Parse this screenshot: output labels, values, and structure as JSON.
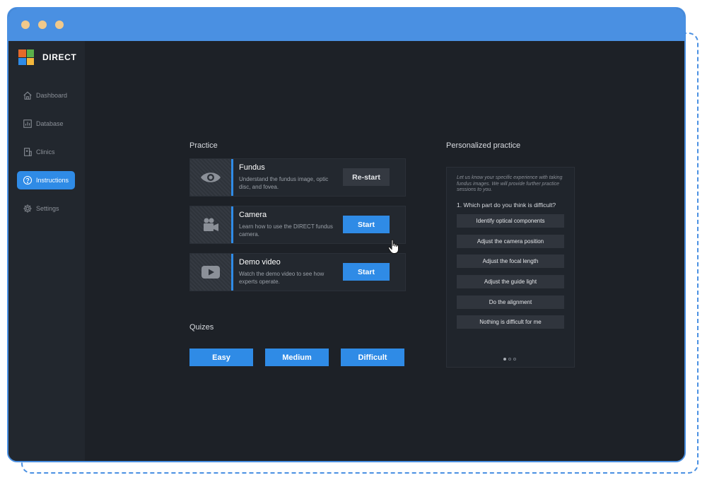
{
  "app": {
    "name": "DIRECT"
  },
  "sidebar": {
    "items": [
      {
        "label": "Dashboard",
        "icon": "home-icon"
      },
      {
        "label": "Database",
        "icon": "chart-icon"
      },
      {
        "label": "Clinics",
        "icon": "clinic-icon"
      },
      {
        "label": "Instructions",
        "icon": "question-icon",
        "active": true
      },
      {
        "label": "Settings",
        "icon": "gear-icon"
      }
    ]
  },
  "practice": {
    "title": "Practice",
    "cards": [
      {
        "title": "Fundus",
        "desc": "Understand the fundus image, optic disc, and fovea.",
        "button": "Re-start",
        "icon": "eye-icon"
      },
      {
        "title": "Camera",
        "desc": "Learn how to use the DIRECT fundus camera.",
        "button": "Start",
        "icon": "video-camera-icon"
      },
      {
        "title": "Demo video",
        "desc": "Watch the demo video to see how experts operate.",
        "button": "Start",
        "icon": "play-icon"
      }
    ]
  },
  "quizzes": {
    "title": "Quizes",
    "buttons": [
      "Easy",
      "Medium",
      "Difficult"
    ]
  },
  "personalized": {
    "title": "Personalized practice",
    "intro": "Let us know your specific experience with taking fundus images. We will provide further practice sessions to you.",
    "question": "1. Which part do you think is difficult?",
    "options": [
      "Identify optical components",
      "Adjust the camera position",
      "Adjust the focal length",
      "Adjust the guide light",
      "Do the alignment",
      "Nothing is difficult for me"
    ],
    "pager": {
      "current": 1,
      "total": 3
    }
  },
  "colors": {
    "accent": "#2f8be6",
    "frame": "#4a90e2",
    "background": "#1d2127"
  }
}
